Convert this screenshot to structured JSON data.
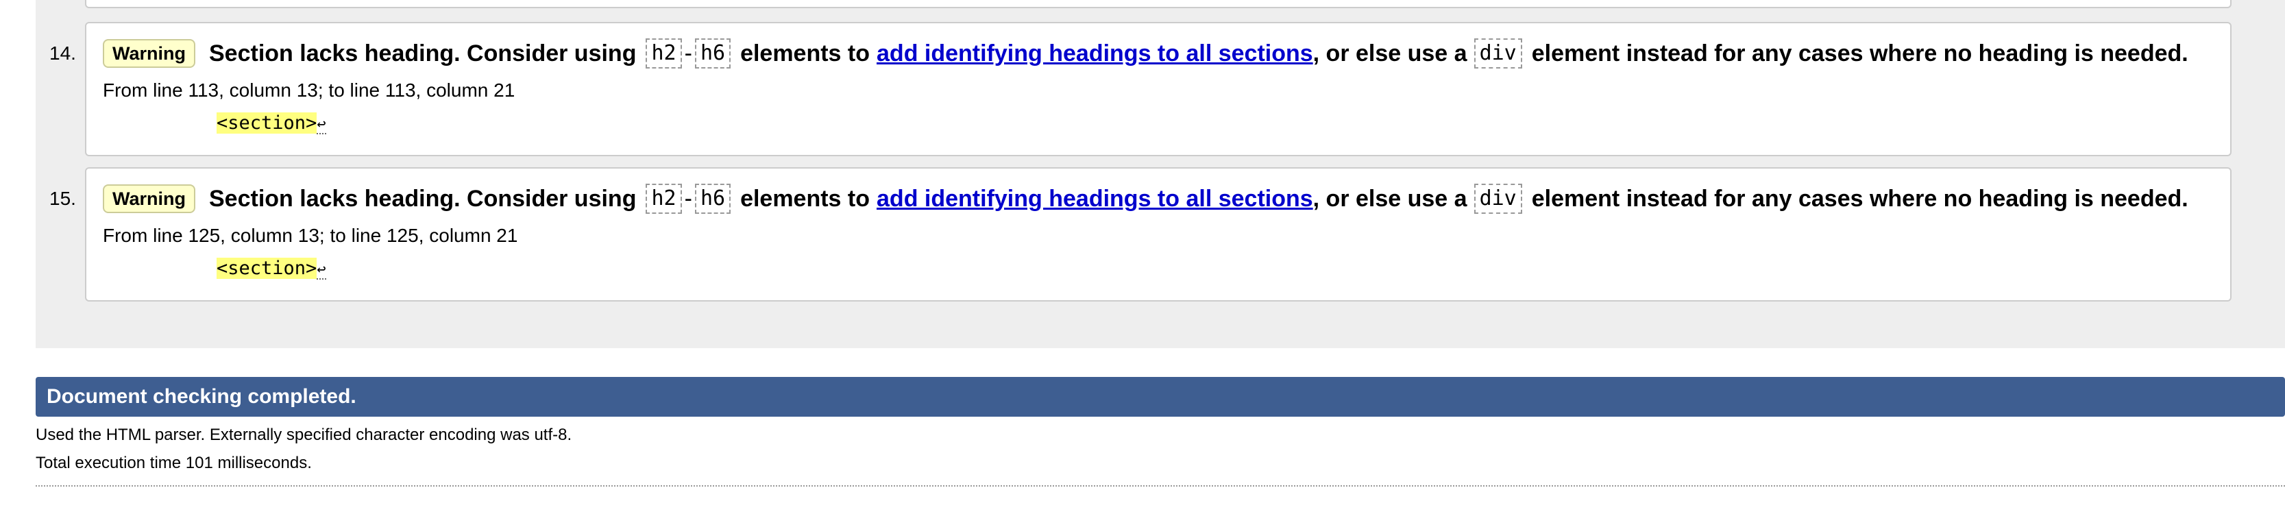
{
  "messages": [
    {
      "number": "14.",
      "badge": "Warning",
      "text_before": "Section lacks heading. Consider using",
      "code_h2": "h2",
      "code_sep": "-",
      "code_h6": "h6",
      "text_mid": "elements to",
      "link_text": "add identifying headings to all sections",
      "text_after_link": ", or else use a",
      "code_div": "div",
      "text_end": "element instead for any cases where no heading is needed.",
      "location": "From line 113, column 13; to line 113, column 21",
      "extract_code": "<section>",
      "return_glyph": "↩"
    },
    {
      "number": "15.",
      "badge": "Warning",
      "text_before": "Section lacks heading. Consider using",
      "code_h2": "h2",
      "code_sep": "-",
      "code_h6": "h6",
      "text_mid": "elements to",
      "link_text": "add identifying headings to all sections",
      "text_after_link": ", or else use a",
      "code_div": "div",
      "text_end": "element instead for any cases where no heading is needed.",
      "location": "From line 125, column 13; to line 125, column 21",
      "extract_code": "<section>",
      "return_glyph": "↩"
    }
  ],
  "status": {
    "title": "Document checking completed.",
    "parser_info": "Used the HTML parser. Externally specified character encoding was utf-8.",
    "execution_time": "Total execution time 101 milliseconds."
  },
  "colors": {
    "status_bar": "#3e5e91",
    "badge_bg": "#ffffcc",
    "highlight": "#ffff80",
    "link": "#0000cc",
    "panel_bg": "#eeeeee"
  }
}
